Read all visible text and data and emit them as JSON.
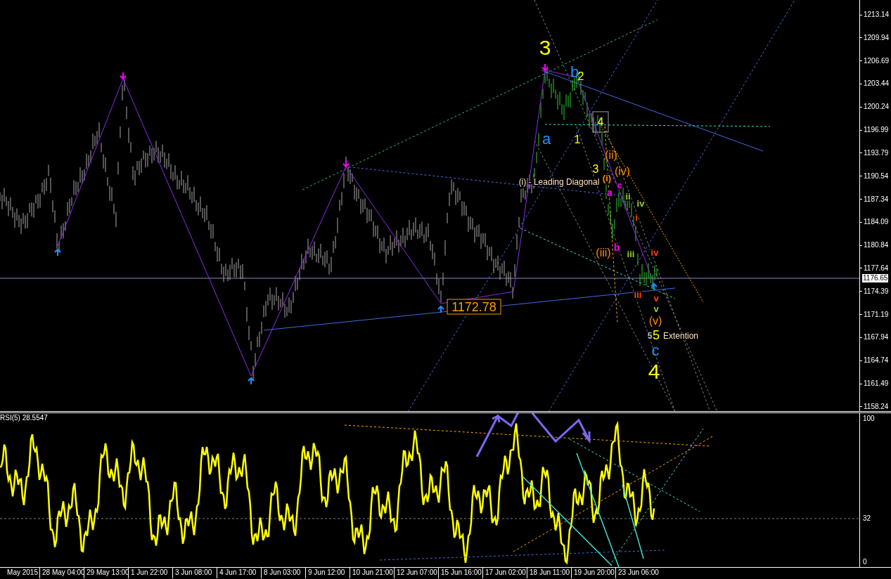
{
  "price_chart": {
    "wave_labels": [
      {
        "text": "3",
        "color": "#ffff00"
      },
      {
        "text": "b",
        "color": "#1e90ff"
      },
      {
        "text": "2",
        "color": "#ffff00"
      },
      {
        "text": "a",
        "color": "#1e90ff"
      },
      {
        "text": "1",
        "color": "#ffff00"
      },
      {
        "text": "4",
        "color": "#ffff00"
      },
      {
        "text": "(ii)",
        "color": "#ff8c00"
      },
      {
        "text": "3",
        "color": "#ffff00"
      },
      {
        "text": "(iv)",
        "color": "#ff8c00"
      },
      {
        "text": "(i)",
        "color": "#ff8c00"
      },
      {
        "text": "(i) - Leading Diagonal",
        "color": "#ffe4c4"
      },
      {
        "text": "a",
        "color": "#ff00ff"
      },
      {
        "text": "c",
        "color": "#ff00ff"
      },
      {
        "text": "ii",
        "color": "#9acd32"
      },
      {
        "text": "iv",
        "color": "#9acd32"
      },
      {
        "text": "i",
        "color": "#ff4500"
      },
      {
        "text": "(iii)",
        "color": "#ff8c00"
      },
      {
        "text": "b",
        "color": "#ff00ff"
      },
      {
        "text": "iii",
        "color": "#9acd32"
      },
      {
        "text": "iv",
        "color": "#ff4500"
      },
      {
        "text": "iii",
        "color": "#ff4500"
      },
      {
        "text": "v",
        "color": "#ff4500"
      },
      {
        "text": "v",
        "color": "#9acd32"
      },
      {
        "text": "(v)",
        "color": "#ff8c00"
      },
      {
        "text": "5",
        "color": "#c0c0c0"
      },
      {
        "text": "5",
        "color": "#ffff00"
      },
      {
        "text": "Extention",
        "color": "#ffe4c4"
      },
      {
        "text": "c",
        "color": "#1e90ff"
      },
      {
        "text": "4",
        "color": "#ffff00"
      }
    ],
    "price_tag": "1172.78",
    "axis_ticks": [
      "1213.14",
      "1209.94",
      "1206.69",
      "1203.44",
      "1200.24",
      "1196.99",
      "1193.79",
      "1190.54",
      "1187.34",
      "1184.09",
      "1180.84",
      "1177.64",
      "1174.39",
      "1171.19",
      "1167.94",
      "1164.74",
      "1161.49",
      "1158.24"
    ],
    "current_price": "1176.65"
  },
  "rsi_panel": {
    "title": "RSI(5) 28.5547",
    "axis_ticks": [
      "100",
      "32",
      "0"
    ]
  },
  "time_axis": [
    "May 2015",
    "28 May 04:00",
    "29 May 13:00",
    "1 Jun 22:00",
    "3 Jun 08:00",
    "4 Jun 17:00",
    "8 Jun 03:00",
    "9 Jun 12:00",
    "10 Jun 21:00",
    "12 Jun 07:00",
    "15 Jun 16:00",
    "17 Jun 02:00",
    "18 Jun 11:00",
    "19 Jun 20:00",
    "23 Jun 06:00"
  ]
}
